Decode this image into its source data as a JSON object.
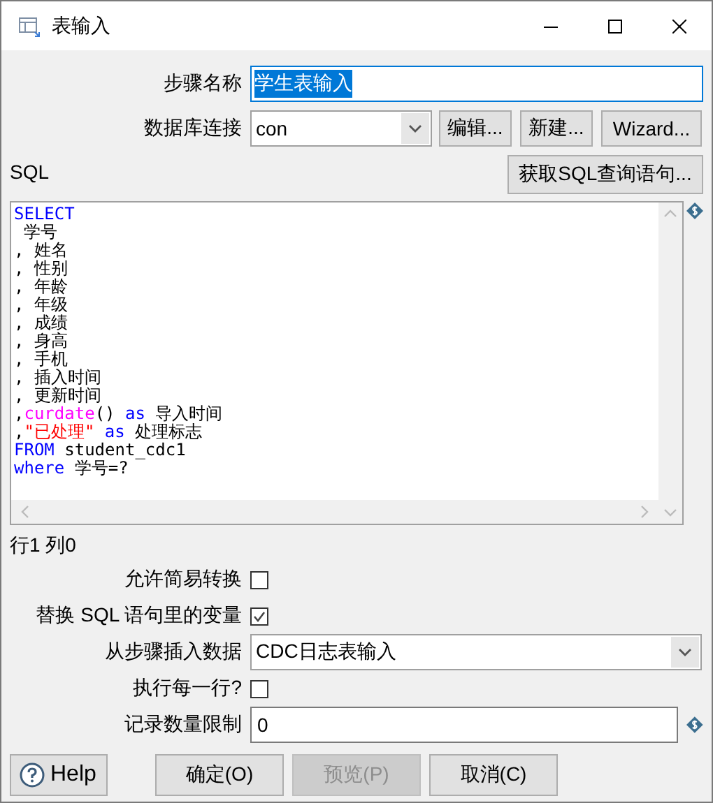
{
  "window": {
    "title": "表输入"
  },
  "step_name": {
    "label": "步骤名称",
    "value": "学生表输入",
    "selected": true
  },
  "connection": {
    "label": "数据库连接",
    "value": "con"
  },
  "connection_buttons": [
    "编辑...",
    "新建...",
    "Wizard..."
  ],
  "sql_label": "SQL",
  "get_sql_button": "获取SQL查询语句...",
  "sql_lines": [
    [
      {
        "kind": "keyword",
        "text": "SELECT"
      }
    ],
    [
      {
        "kind": "plain",
        "text": " 学号"
      }
    ],
    [
      {
        "kind": "plain",
        "text": ", 姓名"
      }
    ],
    [
      {
        "kind": "plain",
        "text": ", 性别"
      }
    ],
    [
      {
        "kind": "plain",
        "text": ", 年龄"
      }
    ],
    [
      {
        "kind": "plain",
        "text": ", 年级"
      }
    ],
    [
      {
        "kind": "plain",
        "text": ", 成绩"
      }
    ],
    [
      {
        "kind": "plain",
        "text": ", 身高"
      }
    ],
    [
      {
        "kind": "plain",
        "text": ", 手机"
      }
    ],
    [
      {
        "kind": "plain",
        "text": ", 插入时间"
      }
    ],
    [
      {
        "kind": "plain",
        "text": ", 更新时间"
      }
    ],
    [
      {
        "kind": "plain",
        "text": ","
      },
      {
        "kind": "function",
        "text": "curdate"
      },
      {
        "kind": "plain",
        "text": "() "
      },
      {
        "kind": "keyword",
        "text": "as"
      },
      {
        "kind": "plain",
        "text": " 导入时间"
      }
    ],
    [
      {
        "kind": "plain",
        "text": ","
      },
      {
        "kind": "string",
        "text": "\"已处理\""
      },
      {
        "kind": "keyword",
        "text": " as"
      },
      {
        "kind": "plain",
        "text": " 处理标志"
      }
    ],
    [
      {
        "kind": "keyword",
        "text": "FROM"
      },
      {
        "kind": "plain",
        "text": " student_cdc1"
      }
    ],
    [
      {
        "kind": "keyword",
        "text": "where"
      },
      {
        "kind": "plain",
        "text": " 学号=?"
      }
    ]
  ],
  "cursor_position": "行1 列0",
  "options": [
    {
      "kind": "checkbox",
      "label": "允许简易转换",
      "checked": false
    },
    {
      "kind": "checkbox",
      "label": "替换 SQL 语句里的变量",
      "checked": true
    },
    {
      "kind": "dropdown",
      "label": "从步骤插入数据",
      "value": "CDC日志表输入"
    },
    {
      "kind": "checkbox",
      "label": "执行每一行?",
      "checked": false
    },
    {
      "kind": "text",
      "label": "记录数量限制",
      "value": "0"
    }
  ],
  "buttons": [
    {
      "kind": "help",
      "label": "Help",
      "disabled": false
    },
    {
      "kind": "plain",
      "label": "确定(O)",
      "disabled": false
    },
    {
      "kind": "plain",
      "label": "预览(P)",
      "disabled": true
    },
    {
      "kind": "plain",
      "label": "取消(C)",
      "disabled": false
    }
  ]
}
